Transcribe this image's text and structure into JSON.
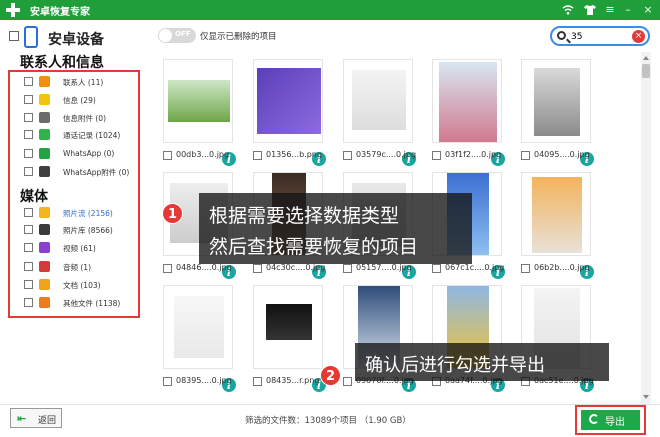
{
  "app": {
    "title": "安卓恢复专家",
    "colors": {
      "brand": "#1f9e3a",
      "accent": "#2a6fd6",
      "highlight": "#e53935",
      "info": "#19a5a0"
    },
    "window_icons": [
      "wifi-icon",
      "shirt-icon",
      "menu-icon",
      "minimize-icon",
      "close-icon"
    ]
  },
  "toolbar": {
    "device_title": "安卓设备",
    "toggle_state": "OFF",
    "toggle_label": "仅显示已删除的项目",
    "search_value": "35"
  },
  "sidebar": {
    "section1_title": "联系人和信息",
    "section2_title": "媒体",
    "items": [
      {
        "label": "联系人 (11)",
        "icon": "contacts-icon",
        "color": "#f0900a"
      },
      {
        "label": "信息 (29)",
        "icon": "message-icon",
        "color": "#f2c40c"
      },
      {
        "label": "信息附件 (0)",
        "icon": "attachment-icon",
        "color": "#6b6b6b"
      },
      {
        "label": "通话记录 (1024)",
        "icon": "phone-icon",
        "color": "#2fb44a"
      },
      {
        "label": "WhatsApp (0)",
        "icon": "whatsapp-icon",
        "color": "#25a244"
      },
      {
        "label": "WhatsApp附件 (0)",
        "icon": "whatsapp-attachment-icon",
        "color": "#3f3f3f"
      },
      {
        "label": "照片流 (2156)",
        "icon": "photo-stream-icon",
        "color": "#f5b51e"
      },
      {
        "label": "照片库 (8566)",
        "icon": "photo-library-icon",
        "color": "#3b3b3b"
      },
      {
        "label": "视频 (61)",
        "icon": "video-icon",
        "color": "#8b3fd0"
      },
      {
        "label": "音频 (1)",
        "icon": "audio-icon",
        "color": "#d33a3a"
      },
      {
        "label": "文档 (103)",
        "icon": "document-icon",
        "color": "#f0a319"
      },
      {
        "label": "其他文件 (1138)",
        "icon": "other-files-icon",
        "color": "#f07c19"
      }
    ]
  },
  "grid": {
    "files": [
      "00db3...0.jpg",
      "01356...b.png",
      "03579c....0.jpg",
      "03f1f2....0.jpg",
      "04095....0.jpg",
      "04846....0.jpg",
      "04c30c....0.jpg",
      "05157....0.jpg",
      "067c1c....0.jpg",
      "06b2b....0.jpg",
      "08395....0.jpg",
      "08435...r.png",
      "09070f....0.jpg",
      "0aa74f....0.jpg",
      "0ac51e....0.jpg"
    ]
  },
  "annotations": {
    "step1": "1",
    "step1_line1": "根据需要选择数据类型",
    "step1_line2": "然后查找需要恢复的项目",
    "step2": "2",
    "step2_line1": "确认后进行勾选并导出"
  },
  "footer": {
    "back_label": "返回",
    "status": "筛选的文件数：13089个项目  （1.90 GB）",
    "export_label": "导出"
  }
}
